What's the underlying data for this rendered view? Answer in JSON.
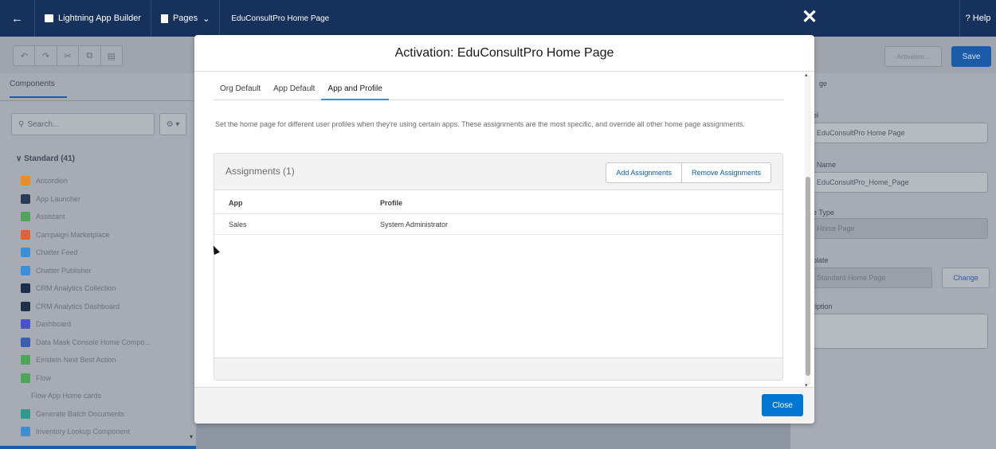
{
  "topbar": {
    "app_title": "Lightning App Builder",
    "pages_label": "Pages",
    "page_name": "EduConsultPro Home Page",
    "help_label": "? Help"
  },
  "toolbar": {
    "activation_label": "Activation...",
    "save_label": "Save"
  },
  "left_panel": {
    "tab_label": "Components",
    "search_placeholder": "Search...",
    "standard_header": "Standard (41)",
    "components": [
      {
        "label": "Accordion",
        "icon": "accordion-icon",
        "color": "#e98a2b"
      },
      {
        "label": "App Launcher",
        "icon": "grid-icon",
        "color": "#2a3a55"
      },
      {
        "label": "Assistant",
        "icon": "assistant-icon",
        "color": "#4fa35a"
      },
      {
        "label": "Campaign Marketplace",
        "icon": "campaign-icon",
        "color": "#e0603a"
      },
      {
        "label": "Chatter Feed",
        "icon": "chatter-feed-icon",
        "color": "#3a8fd8"
      },
      {
        "label": "Chatter Publisher",
        "icon": "chatter-publisher-icon",
        "color": "#3a8fd8"
      },
      {
        "label": "CRM Analytics Collection",
        "icon": "analytics-icon",
        "color": "#1f2f4a"
      },
      {
        "label": "CRM Analytics Dashboard",
        "icon": "analytics-icon",
        "color": "#1f2f4a"
      },
      {
        "label": "Dashboard",
        "icon": "dashboard-icon",
        "color": "#4a52c8"
      },
      {
        "label": "Data Mask Console Home Compo...",
        "icon": "data-mask-icon",
        "color": "#3b5fb0"
      },
      {
        "label": "Einstein Next Best Action",
        "icon": "einstein-icon",
        "color": "#4fa35a"
      },
      {
        "label": "Flow",
        "icon": "flow-icon",
        "color": "#4fa35a"
      },
      {
        "label": "Flow App Home cards",
        "icon": "",
        "color": ""
      },
      {
        "label": "Generate Batch Documents",
        "icon": "generate-icon",
        "color": "#2d9a8a"
      },
      {
        "label": "Inventory Lookup Component",
        "icon": "inventory-icon",
        "color": "#3a8fd8"
      }
    ]
  },
  "right_panel": {
    "label_field": "EduConsultPro Home Page",
    "api_name": "EduConsultPro_Home_Page",
    "page_type": "Home Page",
    "template": "Standard Home Page",
    "change_label": "Change",
    "labels": [
      "ge",
      "el",
      "I Name",
      "e Type",
      "plate",
      "ription"
    ]
  },
  "modal": {
    "title": "Activation: EduConsultPro Home Page",
    "tabs": [
      {
        "label": "Org Default",
        "active": false
      },
      {
        "label": "App Default",
        "active": false
      },
      {
        "label": "App and Profile",
        "active": true
      }
    ],
    "description": "Set the home page for different user profiles when they're using certain apps. These assignments are the most specific, and override all other home page assignments.",
    "assignments": {
      "title": "Assignments (1)",
      "add_label": "Add Assignments",
      "remove_label": "Remove Assignments",
      "columns": [
        "App",
        "Profile"
      ],
      "rows": [
        {
          "app": "Sales",
          "profile": "System Administrator"
        }
      ]
    },
    "close_label": "Close"
  }
}
